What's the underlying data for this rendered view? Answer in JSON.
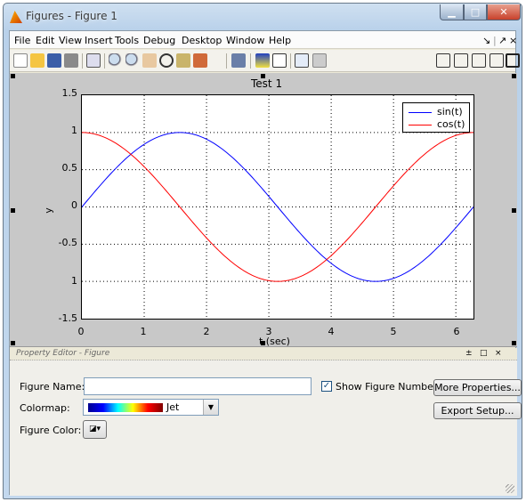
{
  "window": {
    "title": "Figures - Figure 1",
    "min": "▁",
    "max": "□",
    "close": "✕"
  },
  "menu": {
    "items": [
      "File",
      "Edit",
      "View",
      "Insert",
      "Tools",
      "Debug",
      "Desktop",
      "Window",
      "Help"
    ],
    "right": [
      "↘",
      "|",
      "↗",
      "×"
    ]
  },
  "toolbar": {
    "icons": [
      "new-figure-icon",
      "open-icon",
      "save-icon",
      "print-icon",
      "pointer-icon",
      "zoom-in-icon",
      "zoom-out-icon",
      "pan-icon",
      "rotate-icon",
      "data-cursor-icon",
      "brush-icon",
      "link-icon",
      "colorbar-icon",
      "legend-icon",
      "hide-tools-icon",
      "show-tools-icon"
    ],
    "layout_icons": [
      "tile-icon",
      "split-v-icon",
      "split-h-icon",
      "float-icon",
      "maximize-icon"
    ]
  },
  "chart_data": {
    "type": "line",
    "title": "Test 1",
    "xlabel": "t (sec)",
    "ylabel": "y",
    "xlim": [
      0,
      6.2832
    ],
    "ylim": [
      -1.5,
      1.5
    ],
    "xticks": [
      "0",
      "1",
      "2",
      "3",
      "4",
      "5",
      "6"
    ],
    "yticks": [
      "1.5",
      "1",
      "0.5",
      "0",
      "-0.5",
      "1",
      "-1.5"
    ],
    "grid": true,
    "legend_position": "top-right",
    "series": [
      {
        "name": "sin(t)",
        "color": "#0000ff",
        "function": "sin"
      },
      {
        "name": "cos(t)",
        "color": "#ff0000",
        "function": "cos"
      }
    ]
  },
  "property_editor": {
    "header": "Property Editor - Figure",
    "header_icons": [
      "±",
      "□",
      "×"
    ],
    "figure_name_label": "Figure Name:",
    "figure_name_value": "",
    "show_number_label": "Show Figure Number",
    "show_number_checked": "✓",
    "colormap_label": "Colormap:",
    "colormap_value": "Jet",
    "figure_color_label": "Figure Color:",
    "more_properties": "More Properties...",
    "export_setup": "Export Setup..."
  }
}
